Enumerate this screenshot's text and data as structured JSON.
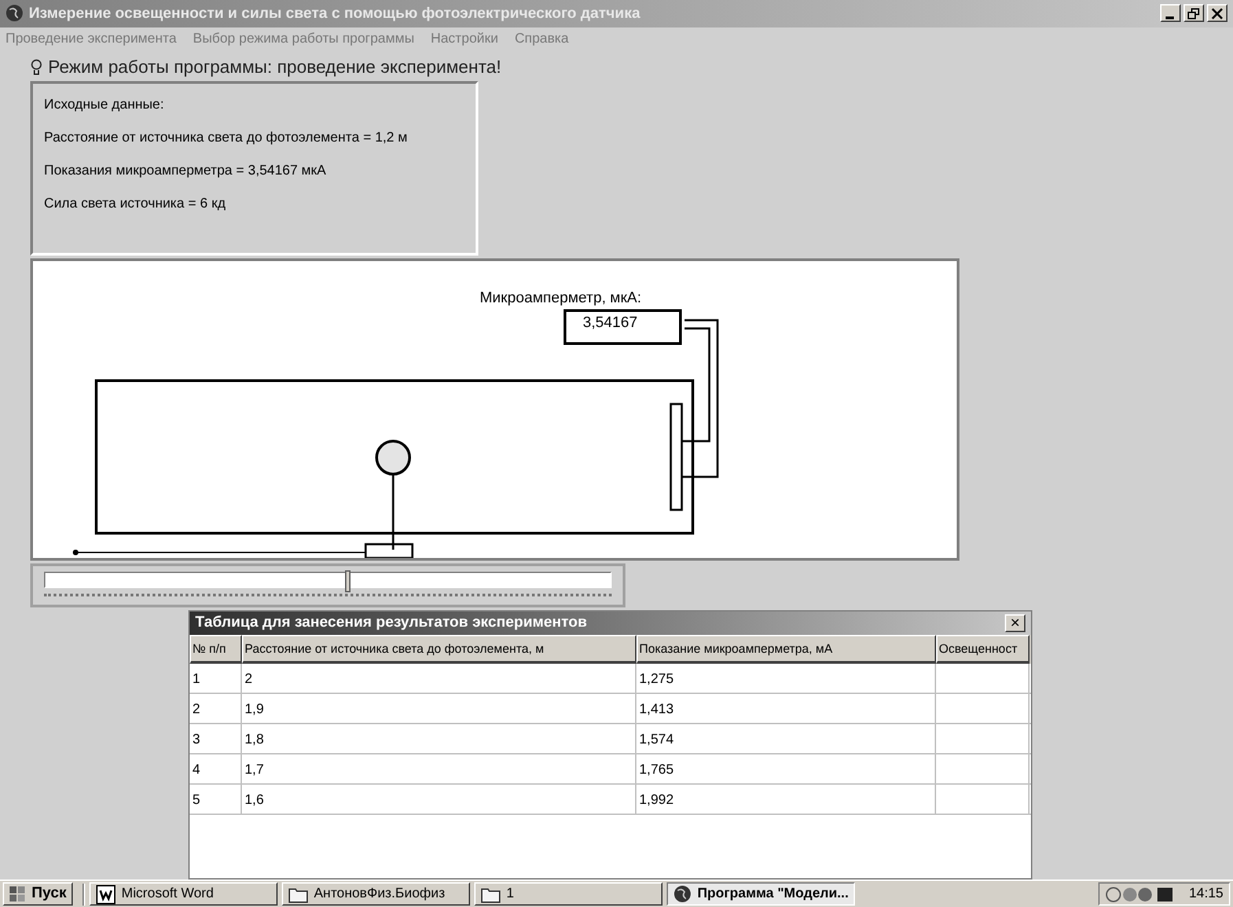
{
  "window": {
    "title": "Измерение освещенности и силы света с помощью фотоэлектрического датчика"
  },
  "menu": [
    "Проведение эксперимента",
    "Выбор режима работы программы",
    "Настройки",
    "Справка"
  ],
  "mode": {
    "label": "Режим работы программы: проведение эксперимента!"
  },
  "info": {
    "lines": [
      "Исходные данные:",
      "Расстояние от источника света до фотоэлемента = 1,2 м",
      "Показания микроамперметра = 3,54167 мкА",
      "Сила света источника = 6 кд"
    ]
  },
  "diagram": {
    "meter_label": "Микроамперметр, мкА:",
    "meter_value": "3,54167"
  },
  "slider": {
    "level": 0.53
  },
  "table": {
    "title": "Таблица для занесения результатов экспериментов",
    "close": "×",
    "columns": [
      "№ п/п",
      "Расстояние от источника света до фотоэлемента, м",
      "Показание микроамперметра, мА",
      "Освещенност"
    ],
    "rows": [
      [
        "1",
        "2",
        "1,275"
      ],
      [
        "2",
        "1,9",
        "1,413"
      ],
      [
        "3",
        "1,8",
        "1,574"
      ],
      [
        "4",
        "1,7",
        "1,765"
      ],
      [
        "5",
        "1,6",
        "1,992"
      ]
    ]
  },
  "taskbar": {
    "start": "Пуск",
    "items": [
      {
        "label": "Microsoft Word",
        "kind": "word",
        "selected": false
      },
      {
        "label": "АнтоновФиз.Биофиз",
        "kind": "folder",
        "selected": false
      },
      {
        "label": "1",
        "kind": "folder",
        "selected": false
      },
      {
        "label": "Программа \"Модели...",
        "kind": "app",
        "selected": true
      }
    ],
    "time": "14:15"
  }
}
